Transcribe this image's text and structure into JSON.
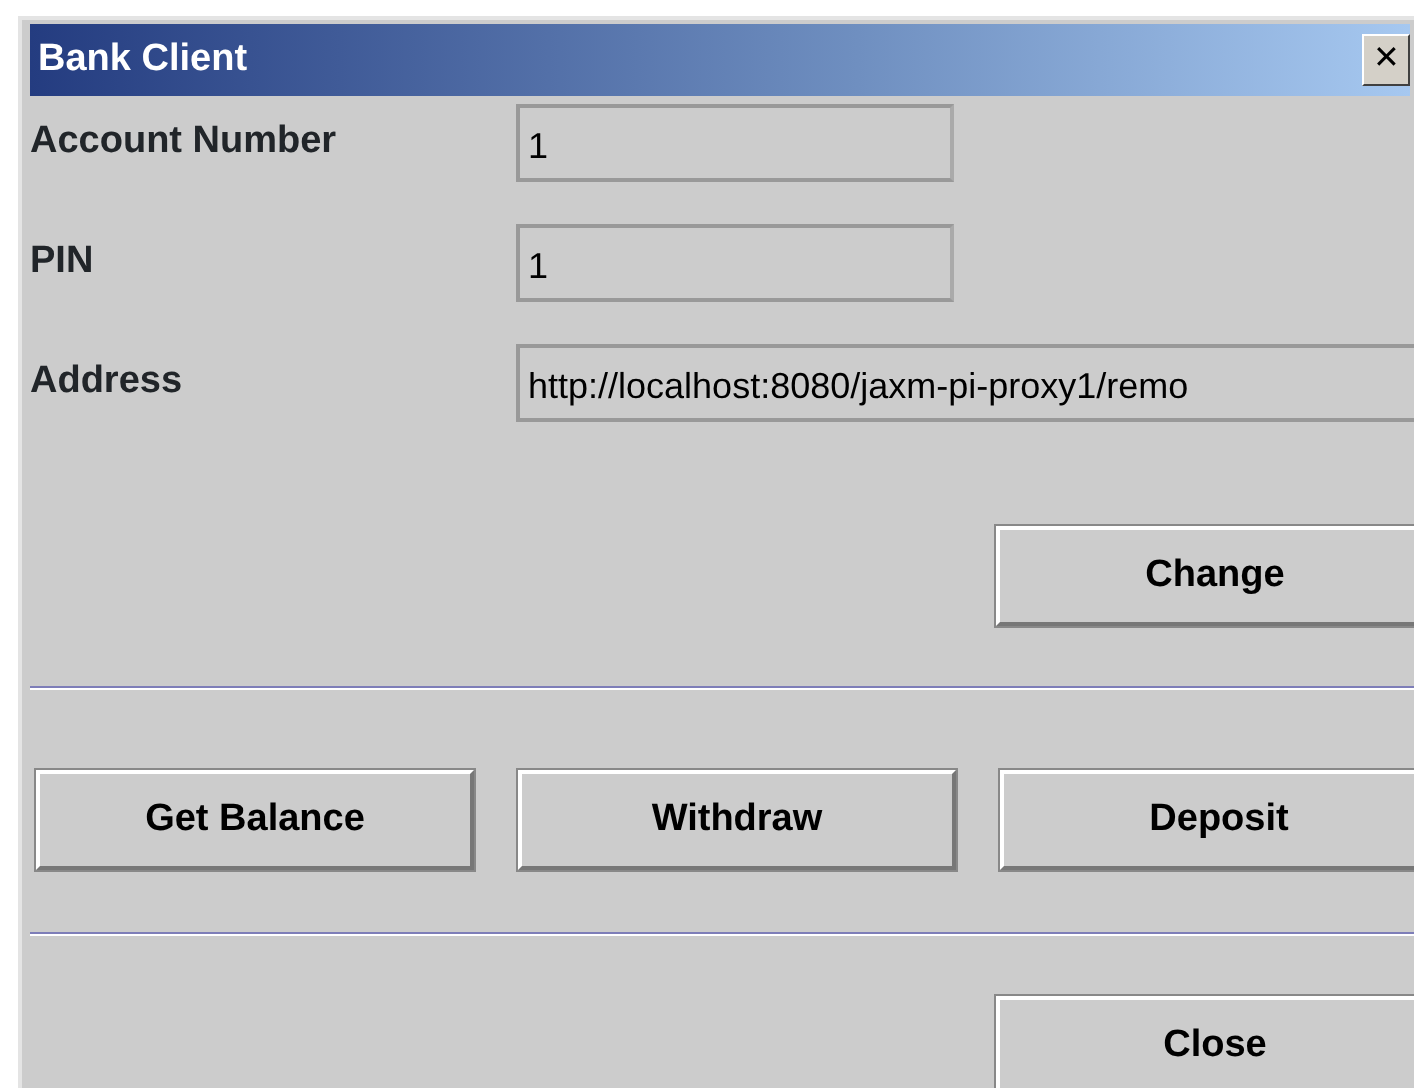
{
  "window": {
    "title": "Bank Client",
    "close_button": "✕"
  },
  "fields": [
    {
      "label": "Account Number",
      "value": "1"
    },
    {
      "label": "PIN",
      "value": "1"
    },
    {
      "label": "Address",
      "value": "http://localhost:8080/jaxm-pi-proxy1/remo"
    }
  ],
  "change_button": "Change",
  "action_buttons": [
    "Get Balance",
    "Withdraw",
    "Deposit"
  ],
  "close_button": "Close"
}
